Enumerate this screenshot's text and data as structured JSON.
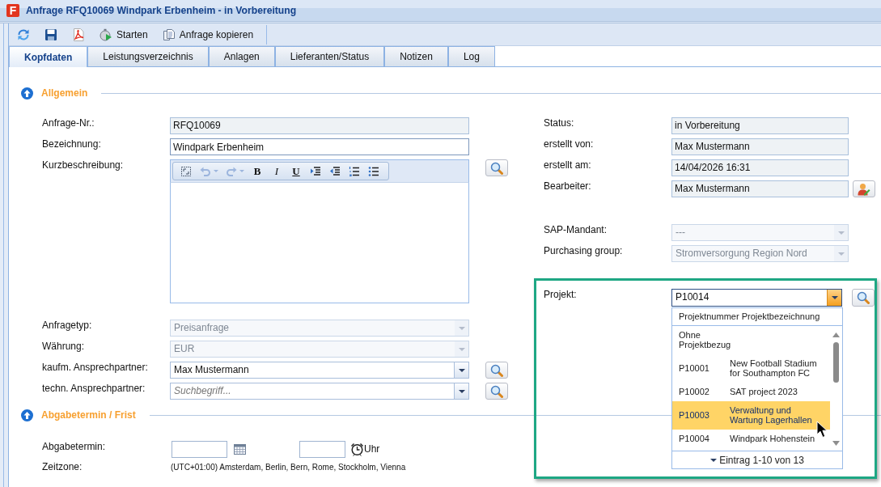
{
  "window": {
    "logo": "F",
    "title": "Anfrage RFQ10069 Windpark Erbenheim - in Vorbereitung"
  },
  "toolbar": [
    {
      "kind": "refresh"
    },
    {
      "kind": "save"
    },
    {
      "kind": "pdf"
    },
    {
      "kind": "start",
      "label": "Starten"
    },
    {
      "kind": "copy",
      "label": "Anfrage kopieren"
    }
  ],
  "tabs": [
    {
      "label": "Kopfdaten",
      "selected": true
    },
    {
      "label": "Leistungsverzeichnis",
      "selected": false
    },
    {
      "label": "Anlagen",
      "selected": false
    },
    {
      "label": "Lieferanten/Status",
      "selected": false
    },
    {
      "label": "Notizen",
      "selected": false
    },
    {
      "label": "Log",
      "selected": false
    }
  ],
  "general": {
    "title": "Allgemein",
    "expanded": true,
    "left_fields": [
      {
        "kind": "readonly",
        "label": "Anfrage-Nr.:",
        "value": "RFQ10069",
        "disabled": false
      },
      {
        "kind": "text",
        "label": "Bezeichnung:",
        "value": "Windpark Erbenheim",
        "disabled": false
      },
      {
        "kind": "editor",
        "label": "Kurzbeschreibung:",
        "disabled": false,
        "button": {
          "kind": "search"
        },
        "toolbar": [
          {
            "kind": "select_all",
            "disabled": false
          },
          {
            "kind": "undo",
            "disabled": true
          },
          {
            "kind": "redo",
            "disabled": true
          },
          {
            "kind": "bold",
            "label": "B",
            "disabled": false
          },
          {
            "kind": "italic",
            "label": "I",
            "disabled": false
          },
          {
            "kind": "underline",
            "label": "U",
            "disabled": false
          },
          {
            "kind": "indent",
            "disabled": false
          },
          {
            "kind": "outdent",
            "disabled": false
          },
          {
            "kind": "ordered_list",
            "disabled": false
          },
          {
            "kind": "bullet_list",
            "disabled": false
          }
        ]
      },
      {
        "kind": "select",
        "label": "Anfragetyp:",
        "value": "Preisanfrage",
        "disabled": true
      },
      {
        "kind": "select",
        "label": "Währung:",
        "value": "EUR",
        "disabled": true
      },
      {
        "kind": "select",
        "label": "kaufm. Ansprechpartner:",
        "value": "Max Mustermann",
        "disabled": false,
        "button": {
          "kind": "search"
        }
      },
      {
        "kind": "select",
        "label": "techn. Ansprechpartner:",
        "placeholder": "Suchbegriff...",
        "disabled": false,
        "button": {
          "kind": "search"
        }
      }
    ],
    "right_groups": [
      [
        {
          "kind": "readonly",
          "label": "Status:",
          "value": "in Vorbereitung",
          "disabled": false
        },
        {
          "kind": "readonly",
          "label": "erstellt von:",
          "value": "Max Mustermann",
          "disabled": false
        },
        {
          "kind": "readonly",
          "label": "erstellt am:",
          "value": "14/04/2026 16:31",
          "disabled": false
        },
        {
          "kind": "readonly",
          "label": "Bearbeiter:",
          "value": "Max Mustermann",
          "disabled": false,
          "button": {
            "kind": "assign"
          }
        }
      ],
      [
        {
          "kind": "select",
          "label": "SAP-Mandant:",
          "value": "---",
          "disabled": true
        },
        {
          "kind": "select",
          "label": "Purchasing group:",
          "value": "Stromversorgung Region Nord",
          "disabled": true
        }
      ],
      [
        {
          "kind": "combo",
          "label": "Projekt:",
          "value": "P10014",
          "disabled": false,
          "expanded": true,
          "button": {
            "kind": "search"
          },
          "dropdown": {
            "header": "Projektnummer Projektbezeichnung",
            "items": [
              {
                "label": "Ohne Projektbezug",
                "selected": false
              },
              {
                "code": "P10001",
                "name": "New Football Stadium for Southampton FC",
                "selected": false
              },
              {
                "code": "P10002",
                "name": "SAT project 2023",
                "selected": false
              },
              {
                "code": "P10003",
                "name": "Verwaltung und Wartung Lagerhallen",
                "selected": true
              },
              {
                "code": "P10004",
                "name": "Windpark Hohenstein",
                "selected": false
              }
            ],
            "footer": "Eintrag 1-10 von 13"
          }
        }
      ]
    ]
  },
  "deadline": {
    "title": "Abgabetermin / Frist",
    "expanded": true,
    "date_label": "Abgabetermin:",
    "time_suffix": "Uhr",
    "timezone_label": "Zeitzone:",
    "timezone": "(UTC+01:00) Amsterdam, Berlin, Bern, Rome, Stockholm, Vienna"
  }
}
